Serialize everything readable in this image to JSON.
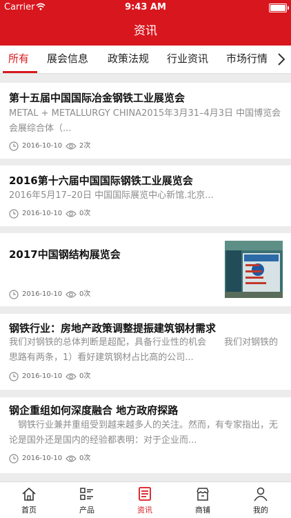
{
  "status_bar": {
    "carrier": "Carrier",
    "time": "9:43 AM"
  },
  "nav": {
    "title": "资讯"
  },
  "tabs": [
    {
      "label": "所有",
      "active": true
    },
    {
      "label": "展会信息",
      "active": false
    },
    {
      "label": "政策法规",
      "active": false
    },
    {
      "label": "行业资讯",
      "active": false
    },
    {
      "label": "市场行情",
      "active": false
    }
  ],
  "articles": [
    {
      "title": "第十五届中国国际冶金钢铁工业展览会",
      "summary": "METAL + METALLURGY CHINA2015年3月31–4月3日 中国博览会会展综合体（...",
      "date": "2016-10-10",
      "views": "2次"
    },
    {
      "title": "2016第十六届中国国际钢铁工业展览会",
      "summary": "2016年5月17–20日  中国国际展览中心新馆.北京...",
      "date": "2016-10-10",
      "views": "0次"
    },
    {
      "title": "2017中国钢结构展览会",
      "date": "2016-10-10",
      "views": "0次"
    },
    {
      "title": "钢铁行业：房地产政策调整提振建筑钢材需求",
      "summary": "我们对钢铁的总体判断是超配，具备行业性的机会　　我们对钢铁的思路有两条，1）看好建筑钢材占比高的公司...",
      "date": "2016-10-10",
      "views": "0次"
    },
    {
      "title": "钢企重组如何深度融合 地方政府探路",
      "summary": "　钢铁行业兼并重组受到越来越多人的关注。然而，有专家指出，无论是国外还是国内的经验都表明：对于企业而...",
      "date": "2016-10-10",
      "views": "0次"
    }
  ],
  "bottom_tabs": [
    {
      "label": "首页",
      "icon": "home-icon",
      "active": false
    },
    {
      "label": "产品",
      "icon": "list-icon",
      "active": false
    },
    {
      "label": "资讯",
      "icon": "news-icon",
      "active": true
    },
    {
      "label": "商铺",
      "icon": "store-icon",
      "active": false
    },
    {
      "label": "我的",
      "icon": "user-icon",
      "active": false
    }
  ],
  "colors": {
    "brand_red": "#d8161d",
    "muted_text": "#8c8c8c",
    "background": "#ececec"
  }
}
